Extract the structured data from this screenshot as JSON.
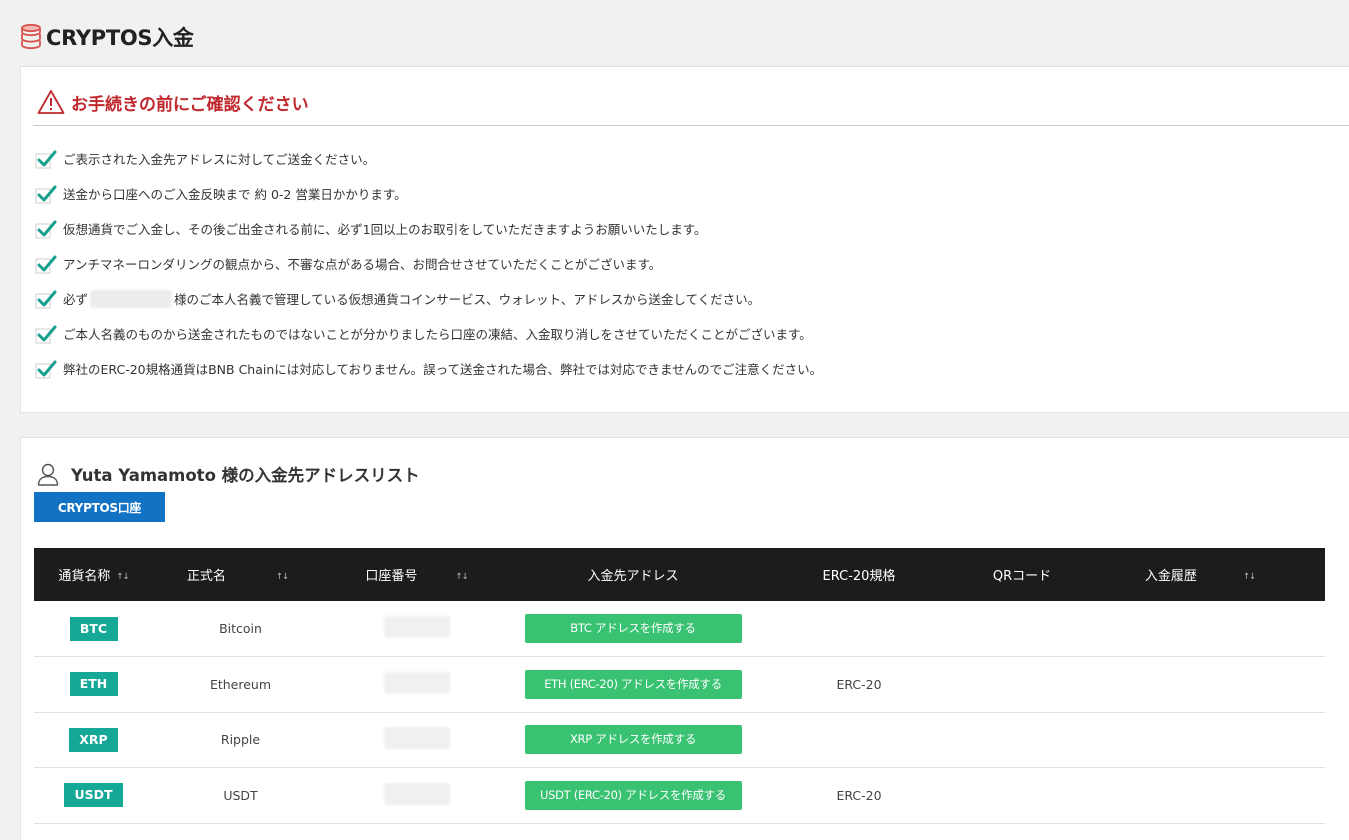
{
  "page": {
    "title": "CRYPTOS入金",
    "icon": "coins-icon"
  },
  "notice": {
    "title": "お手続きの前にご確認ください",
    "icon": "warning-icon",
    "items": [
      {
        "text": "ご表示された入金先アドレスに対してご送金ください。"
      },
      {
        "text": "送金から口座へのご入金反映まで 約 0-2 営業日かかります。"
      },
      {
        "text": "仮想通貨でご入金し、その後ご出金される前に、必ず1回以上のお取引をしていただきますようお願いいたします。"
      },
      {
        "text": "アンチマネーロンダリングの観点から、不審な点がある場合、お問合せさせていただくことがございます。"
      },
      {
        "text_before": "必ず",
        "text_after": "様のご本人名義で管理している仮想通貨コインサービス、ウォレット、アドレスから送金してください。"
      },
      {
        "text": "ご本人名義のものから送金されたものではないことが分かりましたら口座の凍結、入金取り消しをさせていただくことがございます。"
      },
      {
        "text": "弊社のERC-20規格通貨はBNB Chainには対応しておりません。誤って送金された場合、弊社では対応できませんのでご注意ください。"
      }
    ]
  },
  "address_list": {
    "title": "Yuta Yamamoto 様の入金先アドレスリスト",
    "account_tab": "CRYPTOS口座",
    "sort_glyph": "↑↓",
    "columns": {
      "currency": "通貨名称",
      "name": "正式名",
      "account": "口座番号",
      "address": "入金先アドレス",
      "erc20": "ERC-20規格",
      "qr": "QRコード",
      "history": "入金履歴"
    },
    "rows": [
      {
        "currency": "BTC",
        "name": "Bitcoin",
        "button": "BTC アドレスを作成する",
        "erc20": ""
      },
      {
        "currency": "ETH",
        "name": "Ethereum",
        "button": "ETH (ERC-20) アドレスを作成する",
        "erc20": "ERC-20"
      },
      {
        "currency": "XRP",
        "name": "Ripple",
        "button": "XRP アドレスを作成する",
        "erc20": ""
      },
      {
        "currency": "USDT",
        "name": "USDT",
        "button": "USDT (ERC-20) アドレスを作成する",
        "erc20": "ERC-20"
      }
    ]
  },
  "colors": {
    "accent_blue": "#1273c4",
    "badge_teal": "#16a897",
    "button_green": "#38c272",
    "warning_red": "#c0282d",
    "header_black": "#1c1c1c"
  }
}
